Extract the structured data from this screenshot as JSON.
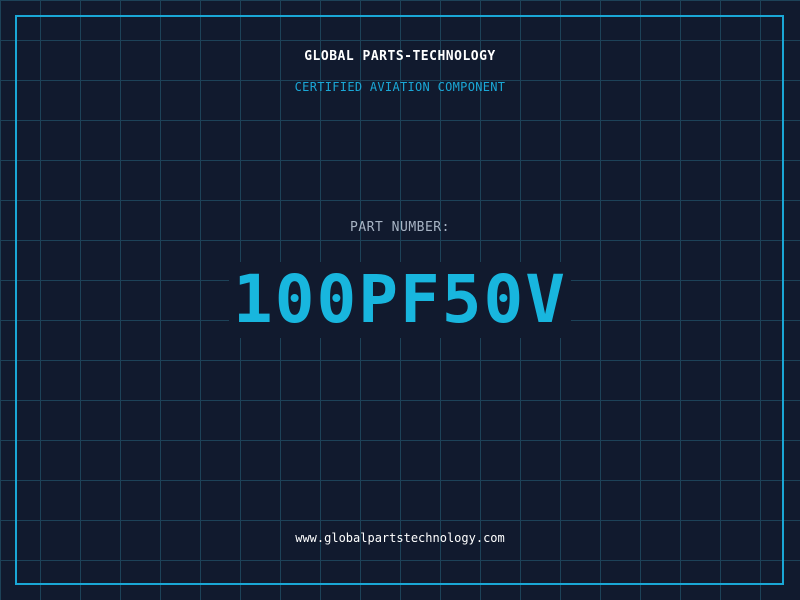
{
  "header": {
    "company_name": "GLOBAL PARTS-TECHNOLOGY",
    "subtitle": "CERTIFIED AVIATION COMPONENT"
  },
  "part": {
    "label": "PART NUMBER:",
    "number": "100PF50V"
  },
  "footer": {
    "website": "www.globalpartstechnology.com"
  },
  "colors": {
    "background": "#111a2e",
    "grid": "#1d4258",
    "accent": "#1aa7d6",
    "part_number": "#18b6de",
    "label": "#a8b4c4",
    "text": "#ffffff"
  }
}
